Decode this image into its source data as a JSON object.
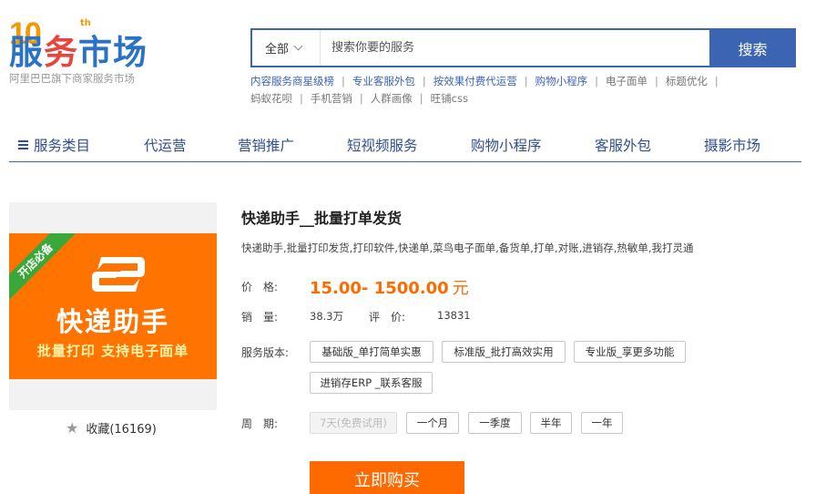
{
  "logo": {
    "ten": "10",
    "th": "th",
    "main_a": "服",
    "main_b": "务",
    "main_c": "市场",
    "subtitle": "阿里巴巴旗下商家服务市场"
  },
  "search": {
    "category": "全部",
    "placeholder": "搜索你要的服务",
    "button": "搜索"
  },
  "hot_links": [
    "内容服务商星级榜",
    "专业客服外包",
    "按效果付费代运营",
    "购物小程序",
    "电子面单",
    "标题优化",
    "蚂蚁花呗",
    "手机营销",
    "人群画像",
    "旺铺css"
  ],
  "nav": {
    "items": [
      "服务类目",
      "代运营",
      "营销推广",
      "短视频服务",
      "购物小程序",
      "客服外包",
      "摄影市场"
    ]
  },
  "product": {
    "image": {
      "ribbon": "开店必备",
      "title": "快递助手",
      "subtitle": "批量打印  支持电子面单"
    },
    "favorite": "收藏(16169)",
    "title": "快递助手__批量打单发货",
    "description": "快递助手,批量打印发货,打印软件,快递单,菜鸟电子面单,备货单,打单,对账,进销存,热敏单,我打灵通",
    "price_label": "价　格:",
    "price": "15.00- 1500.00",
    "price_unit": "元",
    "sales_label": "销　量:",
    "sales": "38.3万",
    "rating_label": "评　价:",
    "rating": "13831",
    "version_label": "服务版本:",
    "versions": [
      "基础版_单打简单实惠",
      "标准版_批打高效实用",
      "专业版_享更多功能",
      "进销存ERP _联系客服"
    ],
    "period_label": "周　期:",
    "periods": [
      "7天(免费试用)",
      "一个月",
      "一季度",
      "半年",
      "一年"
    ],
    "buy_button": "立即购买"
  },
  "colors": {
    "brand_blue": "#3b64b3",
    "accent_orange": "#ff6a00",
    "ribbon_green": "#3aa838"
  }
}
